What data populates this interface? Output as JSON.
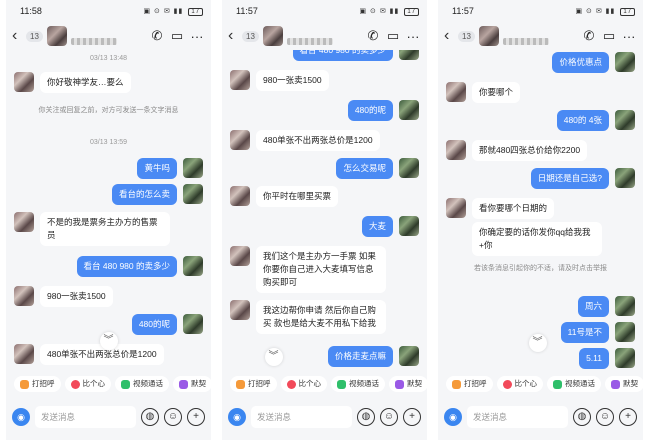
{
  "phones": [
    {
      "time": "11:58",
      "battery": "17",
      "unread": "13",
      "messages": {
        "m0": "你好敬神学友…要么",
        "sys0": "你关注或回复之前，对方可发送一条文字消息",
        "ts0": "03/13 13:59",
        "m1": "黄牛吗",
        "m2": "看台的怎么卖",
        "m3": "不是的我是票务主办方的售票员",
        "m4": "看台 480  980 的卖多少",
        "m5": "980一张卖1500",
        "m6": "480的呢",
        "m7": "480单张不出两张总价是1200",
        "ts_top": "03/13 13:48"
      }
    },
    {
      "time": "11:57",
      "battery": "17",
      "unread": "13",
      "messages": {
        "m0": "看台 480  980 的卖多少",
        "m1": "980一张卖1500",
        "m2": "480的呢",
        "m3": "480单张不出两张总价是1200",
        "m4": "怎么交易呢",
        "m5": "你平时在哪里买票",
        "m6": "大麦",
        "m7": "我们这个是主办方一手票 如果你要你自己进入大麦填写信息购买即可",
        "m8": "我这边帮你申请 然后你自己购买 款也是给大麦不用私下给我",
        "m9": "价格走麦点嘛"
      }
    },
    {
      "time": "11:57",
      "battery": "17",
      "unread": "13",
      "messages": {
        "m0": "价格优惠点",
        "m1": "你要哪个",
        "m2": "480的 4张",
        "m3": "那就480四张总价给你2200",
        "m4": "日期还是自己选?",
        "m5": "看你要哪个日期的",
        "m6": "你确定要的话你发你qq给我我+你",
        "sys0": "若该条消息引起你的不适，请及时点击举报",
        "m7": "周六",
        "m8": "11号是不",
        "m9": "5.11"
      }
    }
  ],
  "chips": [
    "打招呼",
    "比个心",
    "视频通话",
    "默契"
  ],
  "input_placeholder": "发送消息"
}
